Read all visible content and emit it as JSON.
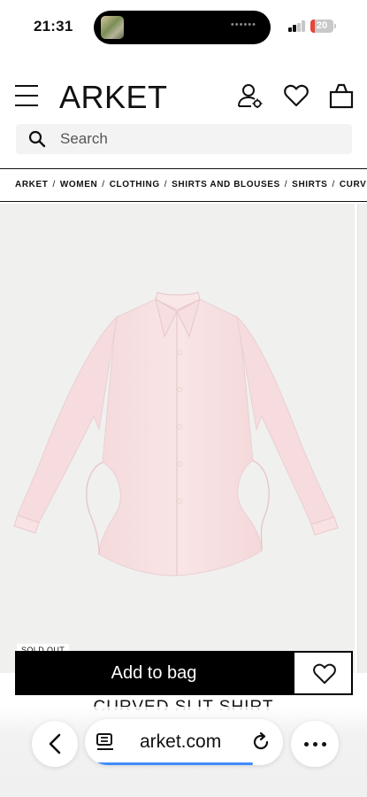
{
  "status_bar": {
    "time": "21:31",
    "battery_level": "20",
    "battery_color": "#e8443a",
    "signal_bars_active": 2,
    "signal_bars_total": 4
  },
  "header": {
    "logo": "ARKET",
    "icons": [
      "menu-icon",
      "account-icon",
      "heart-icon",
      "bag-icon"
    ]
  },
  "search": {
    "placeholder": "Search"
  },
  "breadcrumb": {
    "items": [
      "ARKET",
      "WOMEN",
      "CLOTHING",
      "SHIRTS AND BLOUSES",
      "SHIRTS",
      "CURVED"
    ],
    "separator": "/"
  },
  "product": {
    "badge": "SOLD OUT",
    "title": "CURVED SLIT SHIRT",
    "shirt_color": "#f7dfe1",
    "image_bg": "#f0f0ef"
  },
  "actions": {
    "add_to_bag": "Add to bag",
    "wishlist_icon": "heart-icon"
  },
  "browser": {
    "url": "arket.com",
    "load_progress": 0.9,
    "accent": "#3d8bff",
    "icons": [
      "chevron-left-icon",
      "reader-icon",
      "reload-icon",
      "more-icon"
    ]
  }
}
